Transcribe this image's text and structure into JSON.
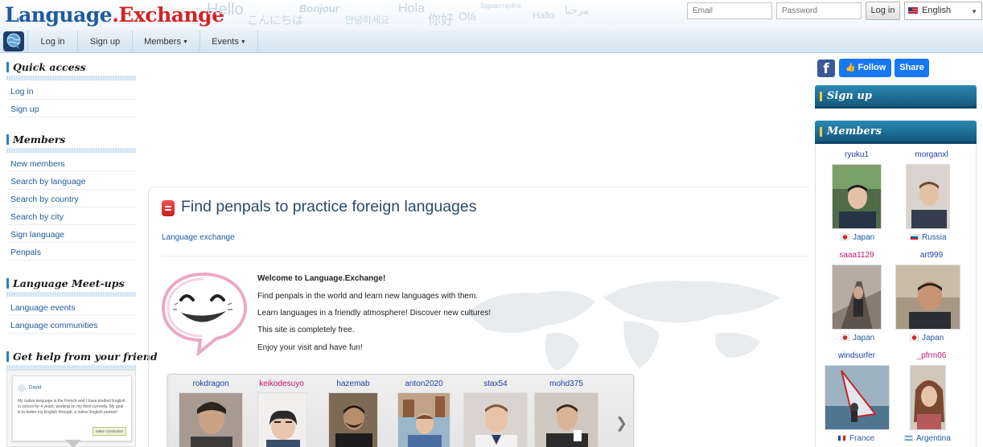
{
  "header": {
    "logo_part1": "Language",
    "logo_part2": ".Exchange",
    "greetings": [
      "Hello",
      "こんにちは",
      "Bonjour",
      "안녕하세요",
      "Hola",
      "你好",
      "Olá",
      "Здравствуйте",
      "Hallo",
      "مرحبا"
    ],
    "email_placeholder": "Email",
    "password_placeholder": "Password",
    "login_button": "Log in",
    "language_select": "English"
  },
  "nav": {
    "items": [
      "Log in",
      "Sign up",
      "Members",
      "Events"
    ]
  },
  "sidebar": {
    "quick_access": {
      "title": "Quick access",
      "links": [
        "Log in",
        "Sign up"
      ]
    },
    "members": {
      "title": "Members",
      "links": [
        "New members",
        "Search by language",
        "Search by country",
        "Search by city",
        "Sign language",
        "Penpals"
      ]
    },
    "meetups": {
      "title": "Language Meet-ups",
      "links": [
        "Language events",
        "Language communities"
      ]
    },
    "help": {
      "title": "Get help from your friend",
      "card_user": "David",
      "card_text": "My native language is the French and I have studied English in school for 4 years, working on my third currently. My goal is to better my English through, a native English partner!",
      "card_button": "Make connection"
    }
  },
  "main": {
    "title": "Find penpals to practice foreign languages",
    "breadcrumb": "Language exchange",
    "welcome_heading": "Welcome to Language.Exchange!",
    "welcome_lines": [
      "Find penpals in the world and learn new languages with them.",
      "Learn languages in a friendly atmosphere! Discover new cultures!",
      "This site is completely free.",
      "Enjoy your visit and have fun!"
    ],
    "strip_members": [
      {
        "name": "rokdragon",
        "color": "#1f3fa8"
      },
      {
        "name": "keikodesuyo",
        "color": "#c2166f"
      },
      {
        "name": "hazemab",
        "color": "#1f3fa8"
      },
      {
        "name": "anton2020",
        "color": "#1f3fa8"
      },
      {
        "name": "stax54",
        "color": "#1f3fa8"
      },
      {
        "name": "mohd375",
        "color": "#1f3fa8"
      }
    ]
  },
  "right": {
    "follow_label": "Follow",
    "share_label": "Share",
    "signup_title": "Sign up",
    "members_title": "Members",
    "members": [
      {
        "name": "ryuku1",
        "country": "Japan",
        "color": "#1f3fa8",
        "flag": "japan"
      },
      {
        "name": "morganxl",
        "country": "Russia",
        "color": "#1f3fa8",
        "flag": "russia"
      },
      {
        "name": "saaa1129",
        "country": "Japan",
        "color": "#c2166f",
        "flag": "japan"
      },
      {
        "name": "art999",
        "country": "Japan",
        "color": "#1f3fa8",
        "flag": "japan"
      },
      {
        "name": "windsurfer",
        "country": "France",
        "color": "#1f3fa8",
        "flag": "france"
      },
      {
        "name": "_pfrm06",
        "country": "Argentina",
        "color": "#c2166f",
        "flag": "argentina"
      }
    ]
  }
}
